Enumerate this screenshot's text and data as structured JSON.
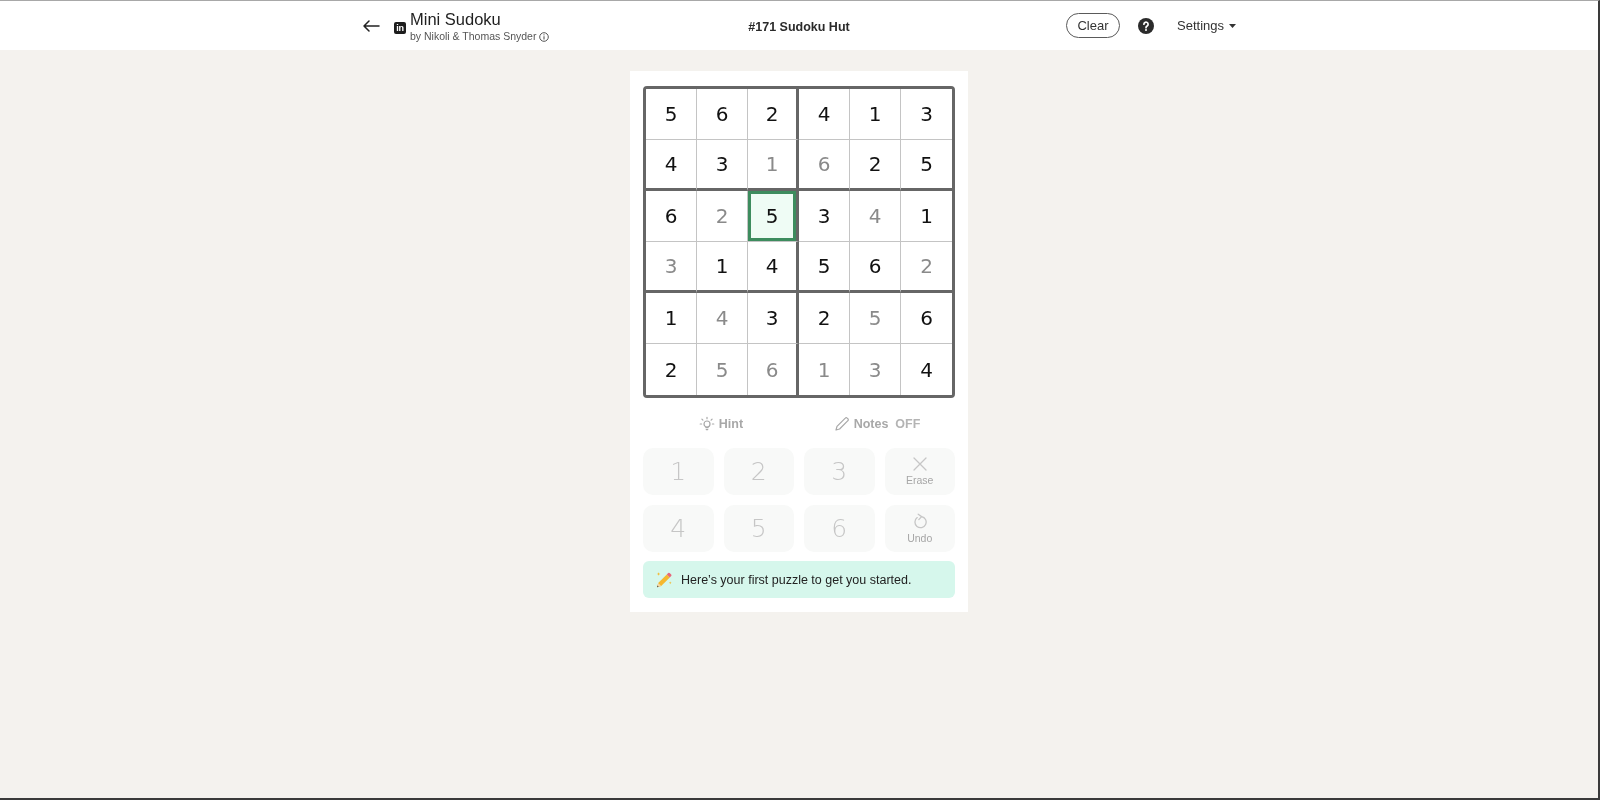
{
  "header": {
    "logo_text": "in",
    "title": "Mini Sudoku",
    "byline": "by Nikoli & Thomas Snyder",
    "puzzle_title": "#171 Sudoku Hut",
    "clear_button": {
      "label": "Clear"
    },
    "settings": {
      "label": "Settings"
    }
  },
  "board": {
    "rows": [
      {
        "cells": [
          {
            "value": "5",
            "given": true,
            "selected": false
          },
          {
            "value": "6",
            "given": true,
            "selected": false
          },
          {
            "value": "2",
            "given": true,
            "selected": false
          },
          {
            "value": "4",
            "given": true,
            "selected": false
          },
          {
            "value": "1",
            "given": true,
            "selected": false
          },
          {
            "value": "3",
            "given": true,
            "selected": false
          }
        ]
      },
      {
        "cells": [
          {
            "value": "4",
            "given": true,
            "selected": false
          },
          {
            "value": "3",
            "given": true,
            "selected": false
          },
          {
            "value": "1",
            "given": false,
            "selected": false
          },
          {
            "value": "6",
            "given": false,
            "selected": false
          },
          {
            "value": "2",
            "given": true,
            "selected": false
          },
          {
            "value": "5",
            "given": true,
            "selected": false
          }
        ]
      },
      {
        "cells": [
          {
            "value": "6",
            "given": true,
            "selected": false
          },
          {
            "value": "2",
            "given": false,
            "selected": false
          },
          {
            "value": "5",
            "given": true,
            "selected": true
          },
          {
            "value": "3",
            "given": true,
            "selected": false
          },
          {
            "value": "4",
            "given": false,
            "selected": false
          },
          {
            "value": "1",
            "given": true,
            "selected": false
          }
        ]
      },
      {
        "cells": [
          {
            "value": "3",
            "given": false,
            "selected": false
          },
          {
            "value": "1",
            "given": true,
            "selected": false
          },
          {
            "value": "4",
            "given": true,
            "selected": false
          },
          {
            "value": "5",
            "given": true,
            "selected": false
          },
          {
            "value": "6",
            "given": true,
            "selected": false
          },
          {
            "value": "2",
            "given": false,
            "selected": false
          }
        ]
      },
      {
        "cells": [
          {
            "value": "1",
            "given": true,
            "selected": false
          },
          {
            "value": "4",
            "given": false,
            "selected": false
          },
          {
            "value": "3",
            "given": true,
            "selected": false
          },
          {
            "value": "2",
            "given": true,
            "selected": false
          },
          {
            "value": "5",
            "given": false,
            "selected": false
          },
          {
            "value": "6",
            "given": true,
            "selected": false
          }
        ]
      },
      {
        "cells": [
          {
            "value": "2",
            "given": true,
            "selected": false
          },
          {
            "value": "5",
            "given": false,
            "selected": false
          },
          {
            "value": "6",
            "given": false,
            "selected": false
          },
          {
            "value": "1",
            "given": false,
            "selected": false
          },
          {
            "value": "3",
            "given": false,
            "selected": false
          },
          {
            "value": "4",
            "given": true,
            "selected": false
          }
        ]
      }
    ]
  },
  "tools": {
    "hint": {
      "label": "Hint",
      "disabled": true
    },
    "notes": {
      "label": "Notes",
      "status": "OFF",
      "disabled": true
    }
  },
  "keypad": {
    "keys": [
      {
        "kind": "digit",
        "label": "1",
        "disabled": true
      },
      {
        "kind": "digit",
        "label": "2",
        "disabled": true
      },
      {
        "kind": "digit",
        "label": "3",
        "disabled": true
      },
      {
        "kind": "erase",
        "label": "Erase",
        "disabled": true
      },
      {
        "kind": "digit",
        "label": "4",
        "disabled": true
      },
      {
        "kind": "digit",
        "label": "5",
        "disabled": true
      },
      {
        "kind": "digit",
        "label": "6",
        "disabled": true
      },
      {
        "kind": "undo",
        "label": "Undo",
        "disabled": true
      }
    ]
  },
  "message": {
    "text": "Here’s your first puzzle to get you started."
  }
}
